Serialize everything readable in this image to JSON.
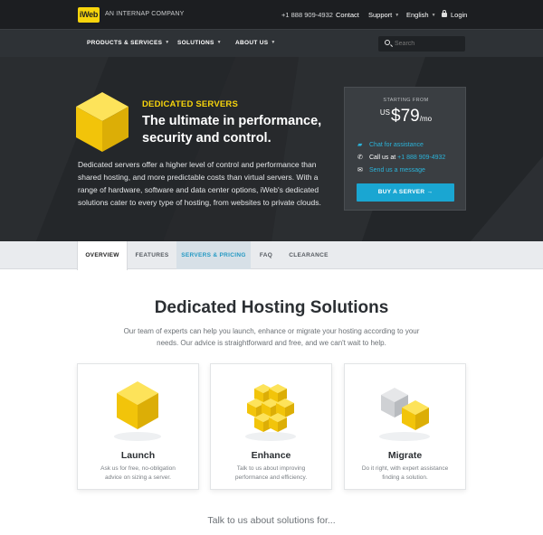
{
  "topbar": {
    "logo": "iWeb",
    "company": "AN INTERNAP COMPANY",
    "phone": "+1 888 909-4932",
    "contact": "Contact",
    "support": "Support",
    "language": "English",
    "login": "Login"
  },
  "nav": {
    "items": [
      "PRODUCTS & SERVICES",
      "SOLUTIONS",
      "ABOUT US"
    ],
    "search_placeholder": "Search"
  },
  "hero": {
    "tag": "DEDICATED SERVERS",
    "title": "The ultimate in performance, security and control.",
    "description": "Dedicated servers offer a higher level of control and performance than shared hosting, and more predictable costs than virtual servers. With a range of hardware, software and data center options, iWeb's dedicated solutions cater to every type of hosting, from websites to private clouds.",
    "price_card": {
      "label": "STARTING FROM",
      "currency": "US",
      "amount": "$79",
      "period": "/mo",
      "chat": "Chat for assistance",
      "call_prefix": "Call us at",
      "call_number": "+1 888 909-4932",
      "message": "Send us a message",
      "button": "BUY A SERVER"
    }
  },
  "tabs": [
    "OVERVIEW",
    "FEATURES",
    "SERVERS & PRICING",
    "FAQ",
    "CLEARANCE"
  ],
  "main": {
    "title": "Dedicated Hosting Solutions",
    "subtitle": "Our team of experts can help you launch, enhance or migrate your hosting according to your needs. Our advice is straightforward and free, and we can't wait to help.",
    "cards": [
      {
        "title": "Launch",
        "desc": "Ask us for free, no-obligation advice on sizing a server."
      },
      {
        "title": "Enhance",
        "desc": "Talk to us about improving performance and efficiency."
      },
      {
        "title": "Migrate",
        "desc": "Do it right, with expert assistance finding a solution."
      }
    ],
    "talk": "Talk to us about solutions for..."
  },
  "colors": {
    "accent_yellow": "#f7d40c",
    "accent_blue": "#1aa6d2",
    "dark_bg": "#26292c"
  }
}
